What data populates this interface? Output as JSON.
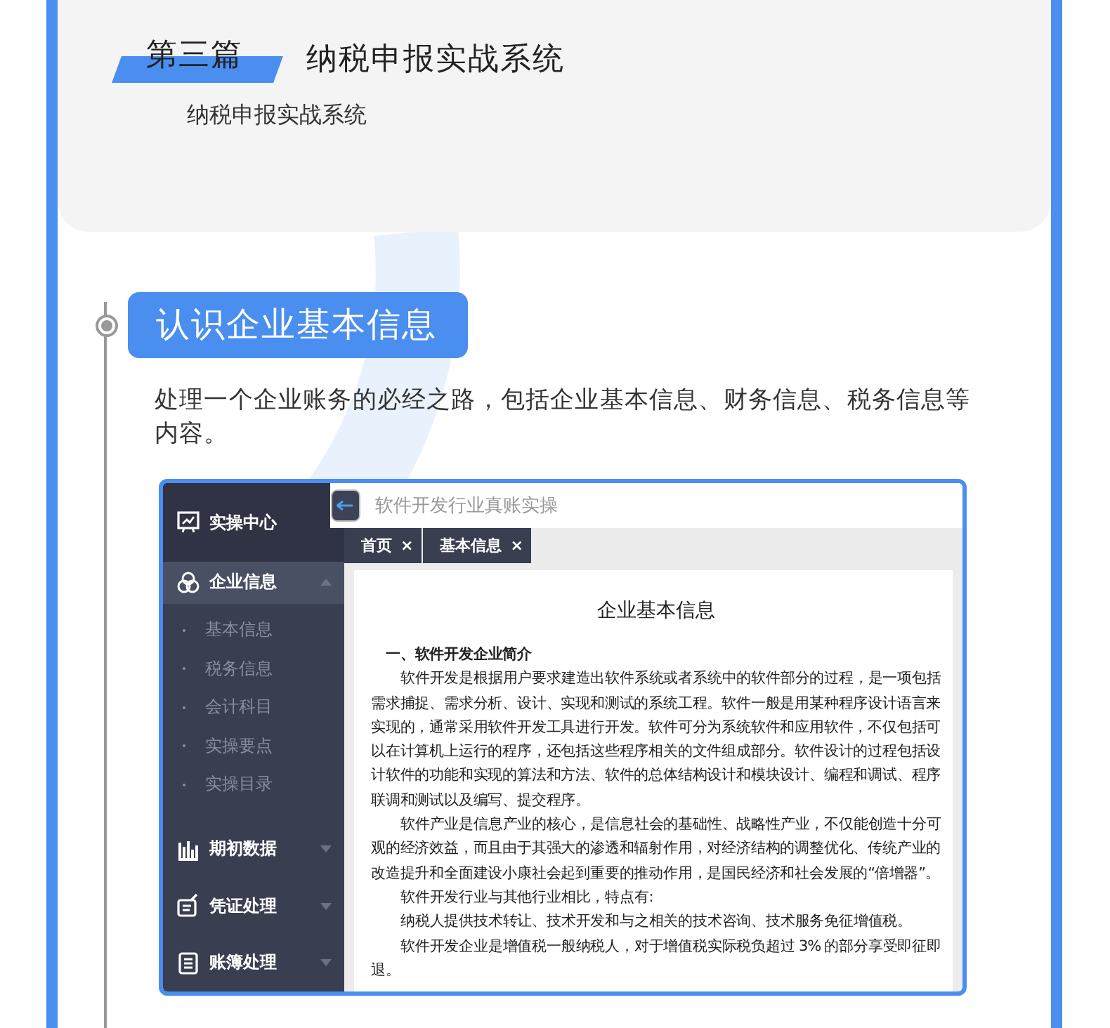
{
  "chapter": {
    "number": "第三篇",
    "title": "纳税申报实战系统",
    "subtitle": "纳税申报实战系统"
  },
  "section": {
    "heading": "认识企业基本信息",
    "description": "处理一个企业账务的必经之路，包括企业基本信息、财务信息、税务信息等内容。"
  },
  "app": {
    "sidebar": {
      "items": [
        {
          "label": "实操中心",
          "kind": "header"
        },
        {
          "label": "企业信息",
          "kind": "group",
          "expanded": true,
          "children": [
            {
              "label": "基本信息"
            },
            {
              "label": "税务信息"
            },
            {
              "label": "会计科目"
            },
            {
              "label": "实操要点"
            },
            {
              "label": "实操目录"
            }
          ]
        },
        {
          "label": "期初数据",
          "kind": "group",
          "expanded": false
        },
        {
          "label": "凭证处理",
          "kind": "group",
          "expanded": false
        },
        {
          "label": "账簿处理",
          "kind": "group",
          "expanded": false
        }
      ]
    },
    "title": "软件开发行业真账实操",
    "tabs": [
      {
        "label": "首页",
        "close": "×"
      },
      {
        "label": "基本信息",
        "close": "×"
      }
    ],
    "document": {
      "title": "企业基本信息",
      "paragraphs": [
        {
          "kind": "heading",
          "text": "一、软件开发企业简介"
        },
        {
          "kind": "body",
          "text": "软件开发是根据用户要求建造出软件系统或者系统中的软件部分的过程，是一项包括需求捕捉、需求分析、设计、实现和测试的系统工程。软件一般是用某种程序设计语言来实现的，通常采用软件开发工具进行开发。软件可分为系统软件和应用软件，不仅包括可以在计算机上运行的程序，还包括这些程序相关的文件组成部分。软件设计的过程包括设计软件的功能和实现的算法和方法、软件的总体结构设计和模块设计、编程和调试、程序联调和测试以及编写、提交程序。"
        },
        {
          "kind": "body",
          "text": "软件产业是信息产业的核心，是信息社会的基础性、战略性产业，不仅能创造十分可观的经济效益，而且由于其强大的渗透和辐射作用，对经济结构的调整优化、传统产业的改造提升和全面建设小康社会起到重要的推动作用，是国民经济和社会发展的“倍增器”。"
        },
        {
          "kind": "body",
          "text": "软件开发行业与其他行业相比，特点有:"
        },
        {
          "kind": "body",
          "text": "纳税人提供技术转让、技术开发和与之相关的技术咨询、技术服务免征增值税。"
        },
        {
          "kind": "body",
          "text": "软件开发企业是增值税一般纳税人，对于增值税实际税负超过 3% 的部分享受即征即退。"
        }
      ]
    }
  }
}
